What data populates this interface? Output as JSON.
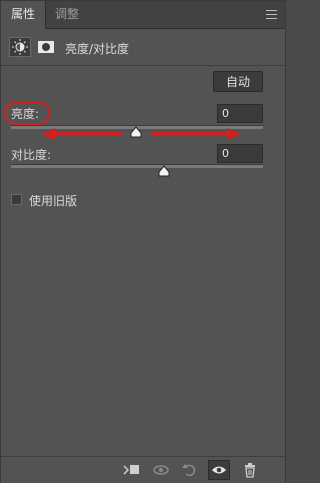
{
  "tabs": [
    "属性",
    "调整"
  ],
  "header": {
    "title": "亮度/对比度"
  },
  "auto_button": "自动",
  "brightness": {
    "label": "亮度:",
    "value": "0",
    "slider_fraction": 0.5
  },
  "contrast": {
    "label": "对比度:",
    "value": "0",
    "slider_fraction": 0.5
  },
  "legacy": {
    "label": "使用旧版",
    "checked": false
  },
  "icons": {
    "panel_menu": "panel-menu-icon",
    "adjustment": "brightness-sun-icon",
    "mask": "layer-mask-icon",
    "clip": "clip-to-layer-icon",
    "view_previous": "view-previous-state-icon",
    "reset": "reset-icon",
    "visibility": "eye-icon",
    "delete": "trash-icon"
  },
  "colors": {
    "panel_bg": "#535353",
    "annotation_red": "#d52020"
  }
}
